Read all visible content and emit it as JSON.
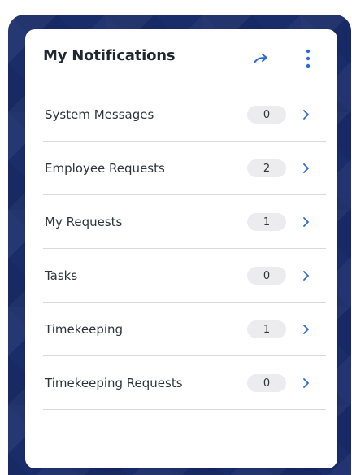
{
  "header": {
    "title": "My Notifications",
    "go_icon": "arrow-right-icon",
    "more_icon": "more-vertical-icon"
  },
  "notifications": [
    {
      "label": "System Messages",
      "count": "0"
    },
    {
      "label": "Employee Requests",
      "count": "2"
    },
    {
      "label": "My Requests",
      "count": "1"
    },
    {
      "label": "Tasks",
      "count": "0"
    },
    {
      "label": "Timekeeping",
      "count": "1"
    },
    {
      "label": "Timekeeping Requests",
      "count": "0"
    }
  ],
  "colors": {
    "accent": "#2f6bd8",
    "frame": "#1a2d6b",
    "badge_bg": "#ececee",
    "divider": "#d6d9de",
    "text": "#30353d"
  }
}
